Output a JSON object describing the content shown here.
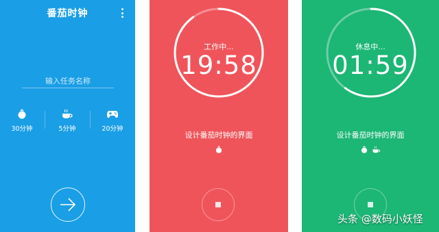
{
  "screens": {
    "setup": {
      "title": "番茄时钟",
      "task_placeholder": "输入任务名称",
      "durations": [
        {
          "label": "30分钟",
          "icon": "tomato-icon"
        },
        {
          "label": "5分钟",
          "icon": "coffee-icon"
        },
        {
          "label": "20分钟",
          "icon": "gamepad-icon"
        }
      ],
      "start_icon": "arrow-right-icon",
      "menu_icon": "more-vertical-icon"
    },
    "working": {
      "status": "工作中...",
      "time": "19:58",
      "task": "设计番茄时钟的界面",
      "icons": [
        "tomato-icon"
      ],
      "stop_icon": "stop-icon",
      "progress": 0.9,
      "background": "#f0545b"
    },
    "resting": {
      "status": "休息中...",
      "time": "01:59",
      "task": "设计番茄时钟的界面",
      "icons": [
        "tomato-icon",
        "coffee-icon"
      ],
      "stop_icon": "stop-icon",
      "progress": 0.6,
      "background": "#1cb675"
    }
  },
  "colors": {
    "setup_bg": "#1a9ee6",
    "working_bg": "#f0545b",
    "resting_bg": "#1cb675"
  },
  "watermark": "头条 @数码小妖怪"
}
